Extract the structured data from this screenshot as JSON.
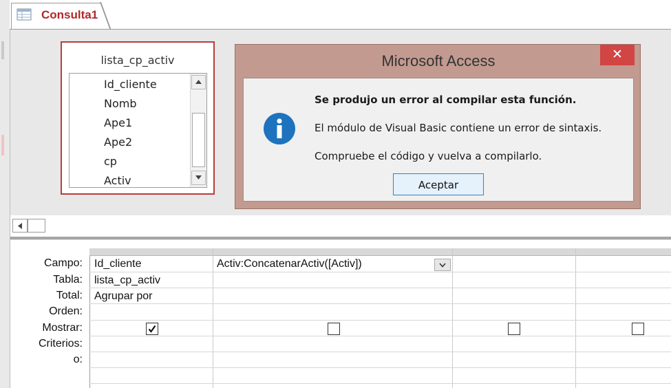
{
  "tab": {
    "label": "Consulta1",
    "icon": "query-icon"
  },
  "table": {
    "name": "lista_cp_activ",
    "fields": [
      "Id_cliente",
      "Nomb",
      "Ape1",
      "Ape2",
      "cp",
      "Activ"
    ]
  },
  "dialog": {
    "title": "Microsoft Access",
    "close_label": "✕",
    "icon": "info-icon",
    "heading": "Se produjo un error al compilar esta función.",
    "line1": "El módulo de Visual Basic contiene un error de sintaxis.",
    "line2": "Compruebe el código y vuelva a compilarlo.",
    "ok_label": "Aceptar"
  },
  "grid": {
    "row_labels": [
      "Campo:",
      "Tabla:",
      "Total:",
      "Orden:",
      "Mostrar:",
      "Criterios:",
      "o:"
    ],
    "columns": [
      {
        "campo": "Id_cliente",
        "tabla": "lista_cp_activ",
        "total": "Agrupar por",
        "mostrar": true
      },
      {
        "campo": "Activ:ConcatenarActiv([Activ])",
        "tabla": "",
        "total": "",
        "mostrar": false
      },
      {
        "campo": "",
        "tabla": "",
        "total": "",
        "mostrar": false
      },
      {
        "campo": "",
        "tabla": "",
        "total": "",
        "mostrar": false
      }
    ]
  },
  "colors": {
    "tab_label": "#b32628",
    "table_border": "#b83c3c",
    "dialog_frame": "#c29a90",
    "close_button": "#d24545",
    "info_icon": "#1e73be",
    "ok_border": "#3c7fb1"
  }
}
